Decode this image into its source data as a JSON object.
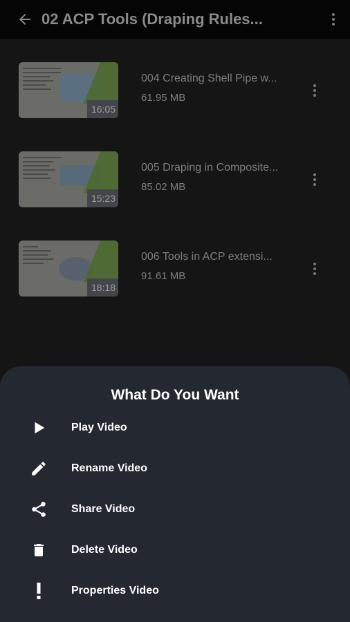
{
  "app_bar": {
    "title": "02 ACP Tools (Draping Rules..."
  },
  "videos": [
    {
      "name": "004 Creating Shell Pipe w...",
      "size": "61.95 MB",
      "duration": "16:05"
    },
    {
      "name": "005 Draping in Composite...",
      "size": "85.02 MB",
      "duration": "15:23"
    },
    {
      "name": "006 Tools in ACP extensi...",
      "size": "91.61 MB",
      "duration": "18:18"
    }
  ],
  "sheet": {
    "title": "What Do You Want",
    "items": [
      {
        "label": "Play Video",
        "icon": "play-icon"
      },
      {
        "label": "Rename Video",
        "icon": "pencil-icon"
      },
      {
        "label": "Share Video",
        "icon": "share-icon"
      },
      {
        "label": "Delete Video",
        "icon": "trash-icon"
      },
      {
        "label": "Properties Video",
        "icon": "exclamation-icon"
      }
    ]
  },
  "colors": {
    "background": "#151515",
    "app_bar": "#050505",
    "sheet": "#242831",
    "muted_text": "#7d7d7d",
    "sheet_text": "#ffffff"
  }
}
